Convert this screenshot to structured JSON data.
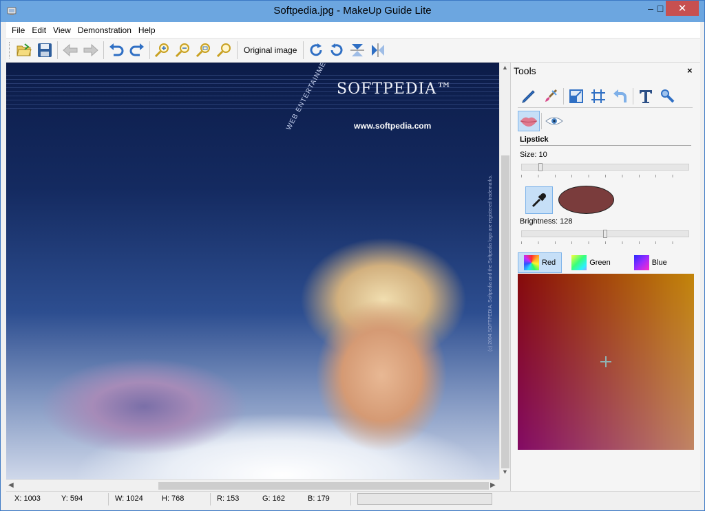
{
  "window": {
    "title": "Softpedia.jpg - MakeUp Guide Lite",
    "minimize_label": "–",
    "maximize_label": "□",
    "close_label": "✕"
  },
  "menu": [
    "File",
    "Edit",
    "View",
    "Demonstration",
    "Help"
  ],
  "toolbar": {
    "original_image_label": "Original image"
  },
  "image": {
    "logo": "SOFTPEDIA™",
    "url": "www.softpedia.com",
    "tagline": "WEB  ENTERTAINMENT",
    "copyright": "(c) 2004 SOFTPEDIA. Softpedia and the Softpedia logo are registered trademarks."
  },
  "tools": {
    "title": "Tools",
    "close": "×",
    "section": "Lipstick",
    "size_label": "Size:",
    "size_value": 10,
    "size_display": "10",
    "size_max": 100,
    "brightness_label": "Brightness:",
    "brightness_value": 128,
    "brightness_display": "128",
    "brightness_max": 255,
    "swatch_color": "#7a3c3c",
    "tabs": [
      "Red",
      "Green",
      "Blue"
    ],
    "active_tab": "Red"
  },
  "status": {
    "x": "X: 1003",
    "y": "Y: 594",
    "w": "W: 1024",
    "h": "H: 768",
    "r": "R: 153",
    "g": "G: 162",
    "b": "B: 179"
  }
}
